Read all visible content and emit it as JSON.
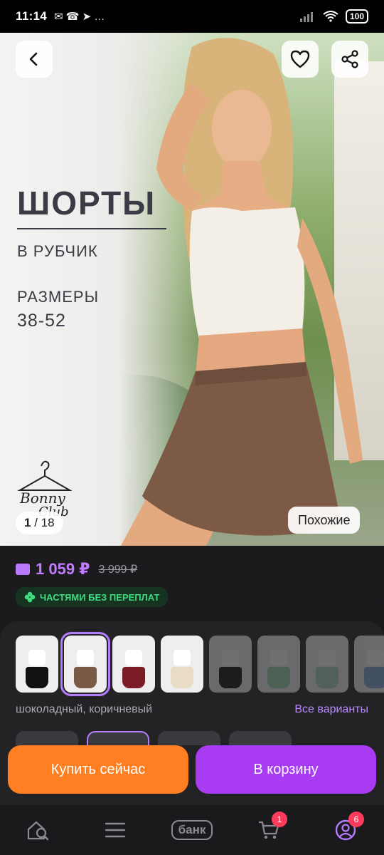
{
  "status_bar": {
    "time": "11:14",
    "notifications": "✉ ☎ ➤ …",
    "battery": "100"
  },
  "hero": {
    "title": "ШОРТЫ",
    "subtitle": "В РУБЧИК",
    "sizes_label": "РАЗМЕРЫ",
    "sizes_value": "38-52",
    "brand": "Bonny Club",
    "page_current": "1",
    "page_total": "/ 18",
    "similar_label": "Похожие"
  },
  "price": {
    "current": "1 059 ₽",
    "old": "3 999 ₽",
    "installments": "ЧАСТЯМИ БЕЗ ПЕРЕПЛАТ"
  },
  "variants": {
    "color_name": "шоколадный, коричневый",
    "all_variants": "Все варианты",
    "thumbs": [
      {
        "shorts": "#111111",
        "selected": false,
        "dim": false
      },
      {
        "shorts": "#7a5a45",
        "selected": true,
        "dim": false
      },
      {
        "shorts": "#7a1b25",
        "selected": false,
        "dim": false
      },
      {
        "shorts": "#e8dcc6",
        "selected": false,
        "dim": false
      },
      {
        "shorts": "#111111",
        "selected": false,
        "dim": true
      },
      {
        "shorts": "#9fd3a6",
        "selected": false,
        "dim": true
      },
      {
        "shorts": "#a8cfc3",
        "selected": false,
        "dim": true
      },
      {
        "shorts": "#7fa3d6",
        "selected": false,
        "dim": true
      }
    ]
  },
  "actions": {
    "buy_now": "Купить сейчас",
    "add_to_cart": "В корзину"
  },
  "nav": {
    "bank": "банк",
    "cart_badge": "1",
    "profile_badge": "6"
  },
  "colors": {
    "accent": "#a93cf2",
    "buy": "#ff7f22",
    "price": "#c27dff",
    "installments": "#3fdc7e"
  }
}
